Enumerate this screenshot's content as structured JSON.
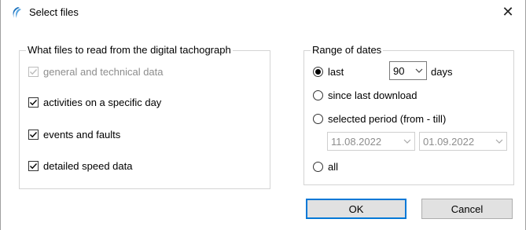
{
  "window": {
    "title": "Select files"
  },
  "files_group": {
    "legend": "What files to read from the digital tachograph",
    "items": [
      {
        "label": "general and technical data",
        "checked": true,
        "disabled": true
      },
      {
        "label": "activities on a specific day",
        "checked": true,
        "disabled": false
      },
      {
        "label": "events and faults",
        "checked": true,
        "disabled": false
      },
      {
        "label": "detailed speed data",
        "checked": true,
        "disabled": false
      }
    ]
  },
  "dates_group": {
    "legend": "Range of dates",
    "last_label": "last",
    "last_value": "90",
    "days_label": "days",
    "since_label": "since last download",
    "period_label": "selected period (from - till)",
    "from_date": "11.08.2022",
    "till_date": "01.09.2022",
    "all_label": "all",
    "selected": "last"
  },
  "buttons": {
    "ok": "OK",
    "cancel": "Cancel"
  },
  "colors": {
    "accent": "#0078d7",
    "icon": "#1e73be"
  },
  "icons": {
    "app": "app-logo-icon",
    "close": "close-icon",
    "chevron": "chevron-down-icon"
  }
}
